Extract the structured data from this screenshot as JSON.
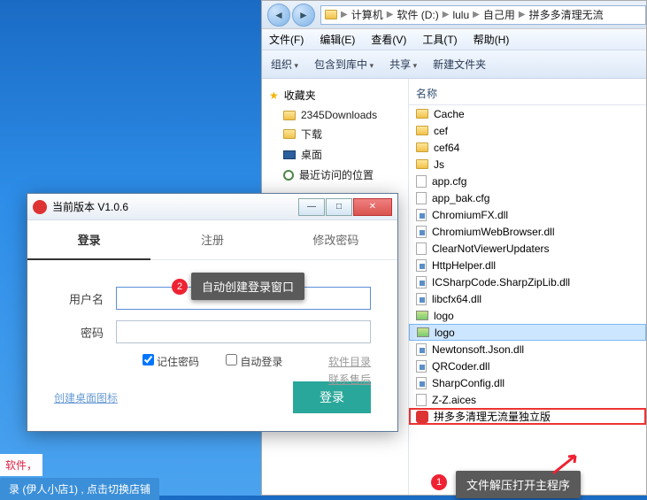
{
  "explorer": {
    "breadcrumbs": [
      "计算机",
      "软件 (D:)",
      "lulu",
      "自己用",
      "拼多多清理无流"
    ],
    "menus": [
      "文件(F)",
      "编辑(E)",
      "查看(V)",
      "工具(T)",
      "帮助(H)"
    ],
    "toolbar": {
      "organize": "组织",
      "include": "包含到库中",
      "share": "共享",
      "newfolder": "新建文件夹"
    },
    "tree": {
      "favorites": "收藏夹",
      "items": [
        "2345Downloads",
        "下载",
        "桌面",
        "最近访问的位置"
      ]
    },
    "listHeader": "名称",
    "files": [
      {
        "name": "Cache",
        "type": "folder"
      },
      {
        "name": "cef",
        "type": "folder"
      },
      {
        "name": "cef64",
        "type": "folder"
      },
      {
        "name": "Js",
        "type": "folder"
      },
      {
        "name": "app.cfg",
        "type": "file"
      },
      {
        "name": "app_bak.cfg",
        "type": "file"
      },
      {
        "name": "ChromiumFX.dll",
        "type": "dll"
      },
      {
        "name": "ChromiumWebBrowser.dll",
        "type": "dll"
      },
      {
        "name": "ClearNotViewerUpdaters",
        "type": "file"
      },
      {
        "name": "HttpHelper.dll",
        "type": "dll"
      },
      {
        "name": "ICSharpCode.SharpZipLib.dll",
        "type": "dll"
      },
      {
        "name": "libcfx64.dll",
        "type": "dll"
      },
      {
        "name": "logo",
        "type": "img"
      },
      {
        "name": "logo",
        "type": "img",
        "selected": true
      },
      {
        "name": "Newtonsoft.Json.dll",
        "type": "dll"
      },
      {
        "name": "QRCoder.dll",
        "type": "dll"
      },
      {
        "name": "SharpConfig.dll",
        "type": "dll"
      },
      {
        "name": "Z-Z.aices",
        "type": "file"
      },
      {
        "name": "拼多多清理无流量独立版",
        "type": "app",
        "highlighted": true
      }
    ]
  },
  "login": {
    "title": "当前版本   V1.0.6",
    "tabs": {
      "login": "登录",
      "register": "注册",
      "changepw": "修改密码"
    },
    "labels": {
      "user": "用户名",
      "pass": "密码"
    },
    "options": {
      "remember": "记住密码",
      "auto": "自动登录"
    },
    "sideLinks": {
      "softdir": "软件目录",
      "aftersale": "联系售后"
    },
    "createShortcut": "创建桌面图标",
    "loginBtn": "登录"
  },
  "callouts": {
    "c1_num": "1",
    "c1_text": "文件解压打开主程序",
    "c2_num": "2",
    "c2_text": "自动创建登录窗口"
  },
  "desktop": {
    "frag1": "软件，",
    "frag2": "录 (伊人小店1) , 点击切换店铺"
  }
}
